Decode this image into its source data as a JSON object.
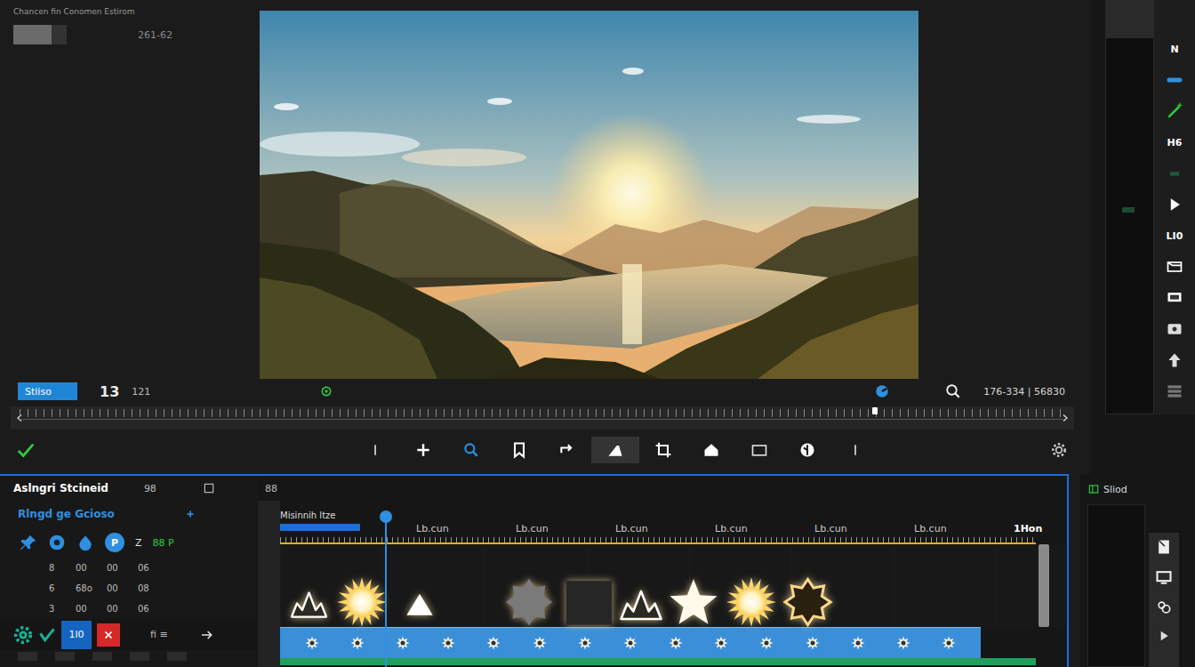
{
  "header": {
    "title": "Chancen fin Conomen Estirom",
    "code": "261-62"
  },
  "controls": {
    "mode": {
      "label": "Stiiso",
      "selected": true
    },
    "frame": "13",
    "fps": "121",
    "timecode": "176-334 | 56830"
  },
  "scrubber": {
    "level": 0.81
  },
  "toolbar": {
    "tools": [
      {
        "kind": "caret",
        "selected": false
      },
      {
        "kind": "plus",
        "selected": false
      },
      {
        "kind": "zoom",
        "selected": false
      },
      {
        "kind": "bookmark",
        "selected": false
      },
      {
        "kind": "redo",
        "selected": false
      },
      {
        "kind": "ramp",
        "selected": true
      },
      {
        "kind": "crop",
        "selected": false
      },
      {
        "kind": "bucket",
        "selected": false
      },
      {
        "kind": "rect",
        "selected": false
      },
      {
        "kind": "globe",
        "selected": false
      },
      {
        "kind": "caret",
        "selected": false
      }
    ]
  },
  "sidebar": {
    "items": [
      {
        "kind": "text",
        "label": "N"
      },
      {
        "kind": "bar"
      },
      {
        "kind": "wand"
      },
      {
        "kind": "text",
        "label": "H6"
      },
      {
        "kind": "dot"
      },
      {
        "kind": "play"
      },
      {
        "kind": "text",
        "label": "LI0"
      },
      {
        "kind": "frame"
      },
      {
        "kind": "screen"
      },
      {
        "kind": "film"
      },
      {
        "kind": "up"
      },
      {
        "kind": "grid"
      }
    ]
  },
  "layers": {
    "title": "Aslngri Stcineid",
    "count": "98",
    "group": "Rlngd ge Gcioso",
    "badge": "P",
    "letter": "Z",
    "code": "88 P",
    "rows": [
      [
        "8",
        "00",
        "00",
        "06"
      ],
      [
        "6",
        "68o",
        "00",
        "08"
      ],
      [
        "3",
        "00",
        "00",
        "06"
      ]
    ]
  },
  "bottom_bar": {
    "value": "1l0",
    "label": "fi ≡"
  },
  "timeline": {
    "header_count": "88",
    "title": "Misinnih ltze",
    "ticks": [
      "Lb.cun",
      "Lb.cun",
      "Lb.cun",
      "Lb.cun",
      "Lb.cun",
      "Lb.cun",
      "1Hon"
    ],
    "playhead": 0.14,
    "effects": [
      {
        "kind": "crown"
      },
      {
        "kind": "sun"
      },
      {
        "kind": "triangle"
      },
      {
        "kind": "splat"
      },
      {
        "kind": "square"
      },
      {
        "kind": "crown"
      },
      {
        "kind": "star"
      },
      {
        "kind": "sun"
      },
      {
        "kind": "ring"
      }
    ]
  },
  "panel": {
    "title": "Sliod"
  }
}
